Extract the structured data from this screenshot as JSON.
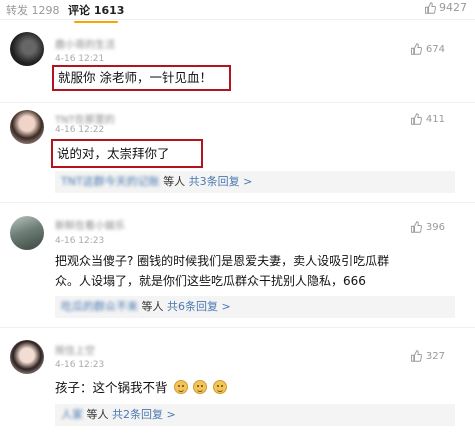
{
  "tabs": {
    "repost": "转发 1298",
    "comments": "评论 1613",
    "likes": "9427"
  },
  "comments": [
    {
      "username": "鹿小哥的生活",
      "time": "4-16 12:21",
      "likes": "674",
      "text": "就服你 涂老师，一针见血！"
    },
    {
      "username": "TNT在那里的",
      "time": "4-16 12:22",
      "likes": "411",
      "text": "说的对，太崇拜你了",
      "replies": {
        "users": "TNT这群今天的记账",
        "etc": "等人",
        "link": "共3条回复 >"
      }
    },
    {
      "username": "新鲜在看小娱乐",
      "time": "4-16 12:23",
      "likes": "396",
      "text_line1": "把观众当傻子? 圈钱的时候我们是恩爱夫妻，卖人设吸引吃瓜群",
      "text_line2": "众。人设塌了，就是你们这些吃瓜群众干扰别人隐私，666",
      "replies": {
        "users": "吃瓜的群众不来",
        "etc": "等人",
        "link": "共6条回复 >"
      }
    },
    {
      "username": "按住上空",
      "time": "4-16 12:23",
      "likes": "327",
      "text": "孩子：这个锅我不背",
      "replies": {
        "users": "人家",
        "etc": "等人",
        "link": "共2条回复 >"
      }
    }
  ],
  "icons": {
    "thumb": "thumbs-up-icon",
    "emoji": "smiley-icon"
  },
  "colors": {
    "highlight_box": "#b4121c",
    "link": "#4a78b0",
    "tab_underline": "#f7a600"
  }
}
